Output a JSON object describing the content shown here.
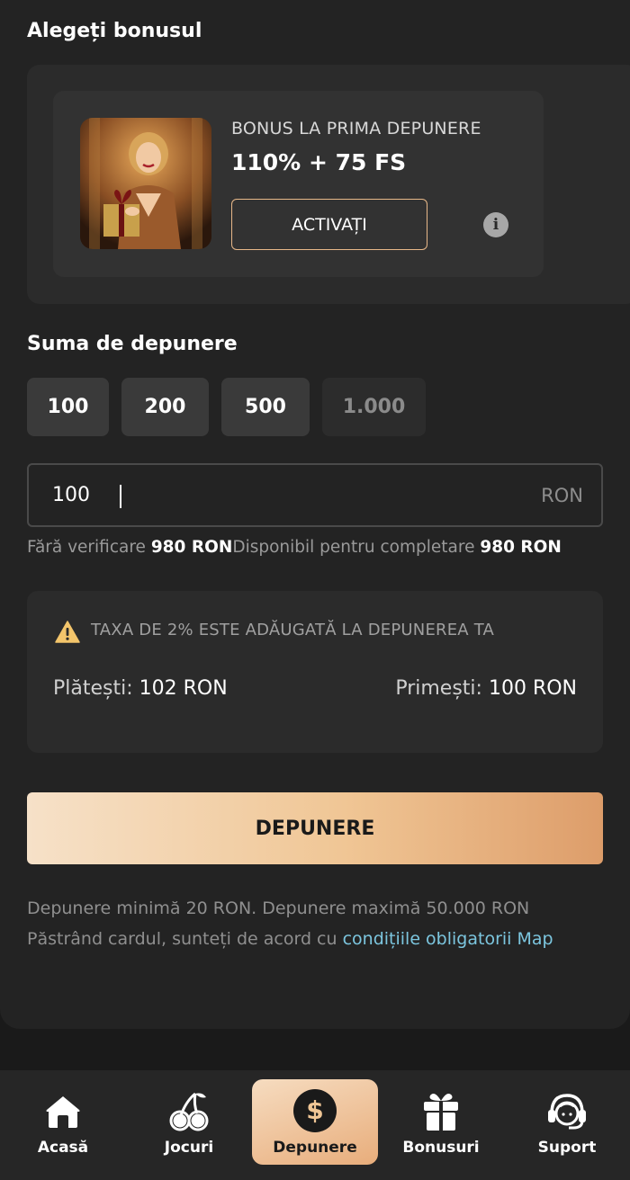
{
  "bonus_section": {
    "title": "Alegeți bonusul",
    "card": {
      "kicker": "BONUS LA PRIMA DEPUNERE",
      "amount": "110% + 75 FS",
      "activate_label": "ACTIVAȚI",
      "info_icon": "info-icon"
    }
  },
  "deposit_section": {
    "title": "Suma de depunere",
    "chips": [
      {
        "label": "100",
        "enabled": true
      },
      {
        "label": "200",
        "enabled": true
      },
      {
        "label": "500",
        "enabled": true
      },
      {
        "label": "1.000",
        "enabled": false
      }
    ],
    "input": {
      "value": "100",
      "currency": "RON"
    },
    "limits": {
      "no_verification_label": "Fără verificare",
      "no_verification_value": "980 RON",
      "available_label": "Disponibil pentru completare",
      "available_value": "980 RON"
    }
  },
  "fee": {
    "warning_icon": "warning-icon",
    "text": "TAXA DE 2% ESTE ADĂUGATĂ LA DEPUNEREA TA",
    "pay_label": "Plătești:",
    "pay_value": "102 RON",
    "receive_label": "Primești:",
    "receive_value": "100 RON"
  },
  "deposit_button_label": "DEPUNERE",
  "notes": {
    "limits_text": "Depunere minimă 20 RON. Depunere maximă 50.000 RON",
    "terms_prefix": "Păstrând cardul, sunteți de acord cu ",
    "terms_link": "condițiile obligatorii Map"
  },
  "bottom_nav": [
    {
      "label": "Acasă",
      "icon": "home-icon",
      "active": false
    },
    {
      "label": "Jocuri",
      "icon": "cherries-icon",
      "active": false
    },
    {
      "label": "Depunere",
      "icon": "dollar-coin-icon",
      "active": true
    },
    {
      "label": "Bonusuri",
      "icon": "gift-icon",
      "active": false
    },
    {
      "label": "Suport",
      "icon": "headset-support-icon",
      "active": false
    }
  ],
  "colors": {
    "accent_border": "#e7b889",
    "link": "#7cc6df",
    "cta_gradient_start": "#f6e1c8",
    "cta_gradient_end": "#dd9d6a",
    "warning": "#f3c56b"
  }
}
